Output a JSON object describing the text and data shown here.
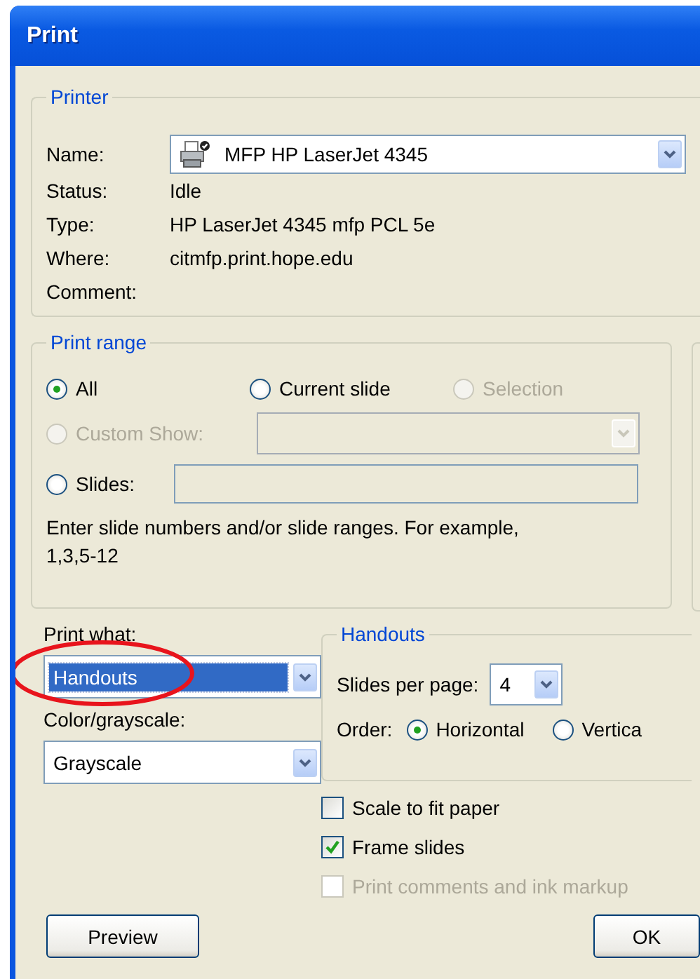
{
  "window": {
    "title": "Print"
  },
  "printer": {
    "legend": "Printer",
    "name_label": "Name:",
    "name_value": "MFP HP LaserJet 4345",
    "details": [
      {
        "label": "Status:",
        "value": "Idle"
      },
      {
        "label": "Type:",
        "value": "HP LaserJet 4345 mfp PCL 5e"
      },
      {
        "label": "Where:",
        "value": "citmfp.print.hope.edu"
      },
      {
        "label": "Comment:"
      }
    ]
  },
  "print_range": {
    "legend": "Print range",
    "options": [
      {
        "kind": "plain",
        "label": "All",
        "selected": true,
        "disabled": false
      },
      {
        "kind": "plain",
        "label": "Current slide",
        "selected": false,
        "disabled": false
      },
      {
        "kind": "plain",
        "label": "Selection",
        "selected": false,
        "disabled": true
      },
      {
        "kind": "combo",
        "label": "Custom Show:",
        "selected": false,
        "disabled": true
      },
      {
        "kind": "field",
        "label": "Slides:",
        "selected": false,
        "disabled": false
      }
    ],
    "hint": [
      "Enter slide numbers and/or slide ranges. For example,",
      "1,3,5-12"
    ]
  },
  "print_what": {
    "label": "Print what:",
    "value": "Handouts",
    "focused": true
  },
  "color": {
    "label": "Color/grayscale:",
    "value": "Grayscale",
    "focused": false
  },
  "handouts": {
    "legend": "Handouts",
    "slides_label": "Slides per page:",
    "slides_value": "4",
    "order_label": "Order:",
    "order": [
      {
        "label": "Horizontal",
        "selected": true
      },
      {
        "label": "Vertica",
        "selected": false
      }
    ]
  },
  "checkboxes": [
    {
      "label": "Scale to fit paper",
      "checked": false,
      "disabled": false
    },
    {
      "label": "Frame slides",
      "checked": true,
      "disabled": false
    },
    {
      "label": "Print comments and ink markup",
      "checked": false,
      "disabled": true
    }
  ],
  "buttons": [
    "Preview",
    "OK"
  ],
  "annotations": [
    {
      "kind": "ellipse"
    }
  ]
}
